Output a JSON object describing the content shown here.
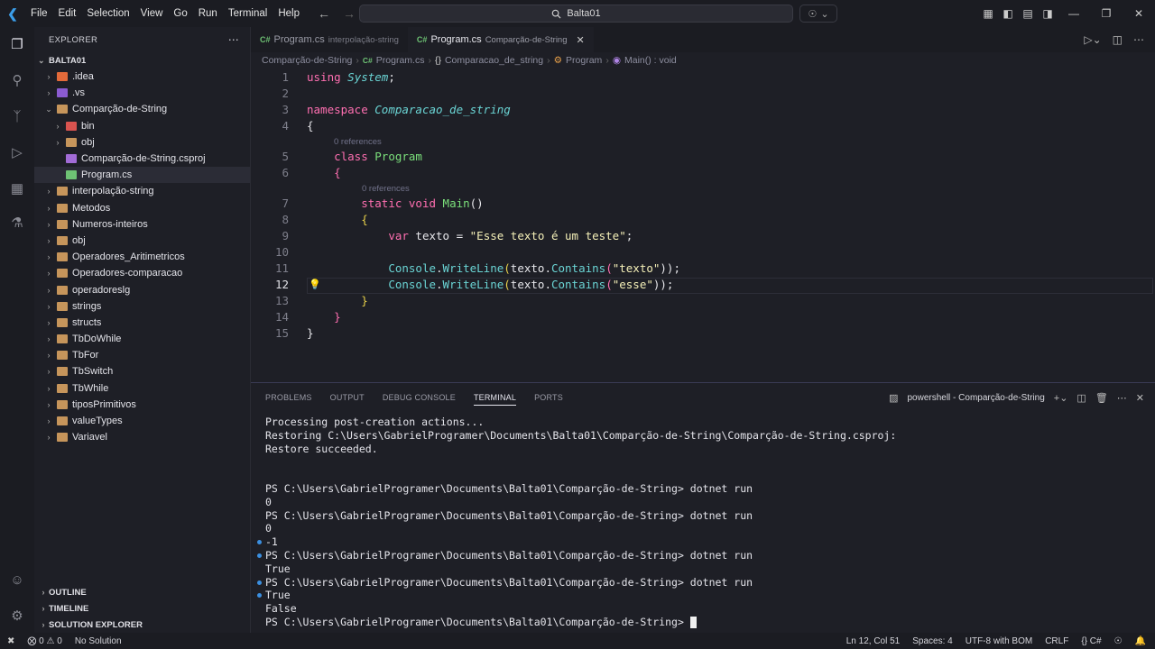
{
  "titlebar": {
    "menu": [
      "File",
      "Edit",
      "Selection",
      "View",
      "Go",
      "Run",
      "Terminal",
      "Help"
    ],
    "search_text": "Balta01"
  },
  "sidebar": {
    "title": "EXPLORER",
    "root": "BALTA01",
    "items": [
      {
        "label": ".idea",
        "indent": 0,
        "chevron": "›",
        "icon_color": "#e36a3a"
      },
      {
        "label": ".vs",
        "indent": 0,
        "chevron": "›",
        "icon_color": "#8b5bd1"
      },
      {
        "label": "Comparção-de-String",
        "indent": 0,
        "chevron": "⌄",
        "icon_color": "#c6955b"
      },
      {
        "label": "bin",
        "indent": 1,
        "chevron": "›",
        "icon_color": "#d9534f"
      },
      {
        "label": "obj",
        "indent": 1,
        "chevron": "›",
        "icon_color": "#c6955b"
      },
      {
        "label": "Comparção-de-String.csproj",
        "indent": 1,
        "chevron": "",
        "icon_color": "#a26cd6"
      },
      {
        "label": "Program.cs",
        "indent": 1,
        "chevron": "",
        "icon_color": "#6ec274",
        "selected": true
      },
      {
        "label": "interpolação-string",
        "indent": 0,
        "chevron": "›",
        "icon_color": "#c6955b"
      },
      {
        "label": "Metodos",
        "indent": 0,
        "chevron": "›",
        "icon_color": "#c6955b"
      },
      {
        "label": "Numeros-inteiros",
        "indent": 0,
        "chevron": "›",
        "icon_color": "#c6955b"
      },
      {
        "label": "obj",
        "indent": 0,
        "chevron": "›",
        "icon_color": "#c6955b"
      },
      {
        "label": "Operadores_Aritimetricos",
        "indent": 0,
        "chevron": "›",
        "icon_color": "#c6955b"
      },
      {
        "label": "Operadores-comparacao",
        "indent": 0,
        "chevron": "›",
        "icon_color": "#c6955b"
      },
      {
        "label": "operadoreslg",
        "indent": 0,
        "chevron": "›",
        "icon_color": "#c6955b"
      },
      {
        "label": "strings",
        "indent": 0,
        "chevron": "›",
        "icon_color": "#c6955b"
      },
      {
        "label": "structs",
        "indent": 0,
        "chevron": "›",
        "icon_color": "#c6955b"
      },
      {
        "label": "TbDoWhile",
        "indent": 0,
        "chevron": "›",
        "icon_color": "#c6955b"
      },
      {
        "label": "TbFor",
        "indent": 0,
        "chevron": "›",
        "icon_color": "#c6955b"
      },
      {
        "label": "TbSwitch",
        "indent": 0,
        "chevron": "›",
        "icon_color": "#c6955b"
      },
      {
        "label": "TbWhile",
        "indent": 0,
        "chevron": "›",
        "icon_color": "#c6955b"
      },
      {
        "label": "tiposPrimitivos",
        "indent": 0,
        "chevron": "›",
        "icon_color": "#c6955b"
      },
      {
        "label": "valueTypes",
        "indent": 0,
        "chevron": "›",
        "icon_color": "#c6955b"
      },
      {
        "label": "Variavel",
        "indent": 0,
        "chevron": "›",
        "icon_color": "#c6955b"
      }
    ],
    "bottom_panels": [
      "OUTLINE",
      "TIMELINE",
      "SOLUTION EXPLORER"
    ]
  },
  "tabs": [
    {
      "label": "Program.cs",
      "desc": "interpolação-string",
      "active": false
    },
    {
      "label": "Program.cs",
      "desc": "Comparção-de-String",
      "active": true
    }
  ],
  "tab_close": "✕",
  "breadcrumb": [
    "Comparção-de-String",
    "Program.cs",
    "Comparacao_de_string",
    "Program",
    "Main() : void"
  ],
  "editor": {
    "line_numbers": [
      "1",
      "2",
      "3",
      "4",
      "5",
      "6",
      "7",
      "8",
      "9",
      "10",
      "11",
      "12",
      "13",
      "14",
      "15"
    ],
    "current_line": "12",
    "codelens_class": "0 references",
    "codelens_main": "0 references",
    "tokens": {
      "using": "using",
      "system": "System",
      "semi": ";",
      "namespace": "namespace",
      "ns_name": "Comparacao_de_string",
      "lbrace": "{",
      "rbrace": "}",
      "class": "class",
      "class_name": "Program",
      "static": "static",
      "void": "void",
      "main": "Main",
      "parens": "()",
      "var": "var",
      "texto": "texto",
      "eq": " = ",
      "str_val": "\"Esse texto é um teste\"",
      "console": "Console",
      "dot": ".",
      "writeline": "WriteLine",
      "contains": "Contains",
      "arg1": "\"texto\"",
      "arg2": "\"esse\"",
      "open": "(",
      "close": ")",
      "close_semi": "));"
    }
  },
  "panel": {
    "tabs": [
      "PROBLEMS",
      "OUTPUT",
      "DEBUG CONSOLE",
      "TERMINAL",
      "PORTS"
    ],
    "active_tab": "TERMINAL",
    "terminal_name": "powershell - Comparção-de-String",
    "lines": [
      {
        "text": "Processing post-creation actions...",
        "dot": false
      },
      {
        "text": "Restoring C:\\Users\\GabrielProgramer\\Documents\\Balta01\\Comparção-de-String\\Comparção-de-String.csproj:",
        "dot": false
      },
      {
        "text": "Restore succeeded.",
        "dot": false
      },
      {
        "text": "",
        "dot": false
      },
      {
        "text": "",
        "dot": false
      },
      {
        "text": "PS C:\\Users\\GabrielProgramer\\Documents\\Balta01\\Comparção-de-String> dotnet run",
        "dot": false
      },
      {
        "text": "0",
        "dot": false
      },
      {
        "text": "PS C:\\Users\\GabrielProgramer\\Documents\\Balta01\\Comparção-de-String> dotnet run",
        "dot": false
      },
      {
        "text": "0",
        "dot": false
      },
      {
        "text": "-1",
        "dot": true
      },
      {
        "text": "PS C:\\Users\\GabrielProgramer\\Documents\\Balta01\\Comparção-de-String> dotnet run",
        "dot": true
      },
      {
        "text": "True",
        "dot": false
      },
      {
        "text": "PS C:\\Users\\GabrielProgramer\\Documents\\Balta01\\Comparção-de-String> dotnet run",
        "dot": true
      },
      {
        "text": "True",
        "dot": true
      },
      {
        "text": "False",
        "dot": false
      }
    ],
    "prompt": "PS C:\\Users\\GabrielProgramer\\Documents\\Balta01\\Comparção-de-String> "
  },
  "statusbar": {
    "errors": "0",
    "warnings": "0",
    "solution": "No Solution",
    "position": "Ln 12, Col 51",
    "spaces": "Spaces: 4",
    "encoding": "UTF-8 with BOM",
    "eol": "CRLF",
    "language": "C#"
  }
}
